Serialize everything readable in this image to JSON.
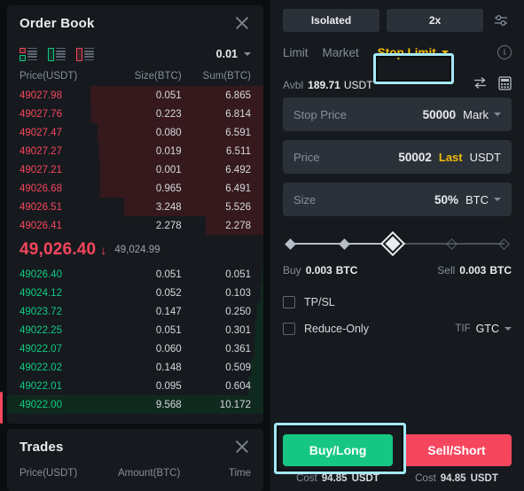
{
  "order_book": {
    "title": "Order Book",
    "close_icon": "close-icon",
    "layout_icons": [
      "orderbook-layout-both-icon",
      "orderbook-layout-bids-icon",
      "orderbook-layout-asks-icon"
    ],
    "tick_size": "0.01",
    "columns": {
      "price": "Price(USDT)",
      "size": "Size(BTC)",
      "sum": "Sum(BTC)"
    },
    "asks": [
      {
        "price": "49027.98",
        "size": "0.051",
        "sum": "6.865",
        "depth_pct": 67.5
      },
      {
        "price": "49027.76",
        "size": "0.223",
        "sum": "6.814",
        "depth_pct": 67.0
      },
      {
        "price": "49027.47",
        "size": "0.080",
        "sum": "6.591",
        "depth_pct": 64.8
      },
      {
        "price": "49027.27",
        "size": "0.019",
        "sum": "6.511",
        "depth_pct": 64.0
      },
      {
        "price": "49027.21",
        "size": "0.001",
        "sum": "6.492",
        "depth_pct": 63.8
      },
      {
        "price": "49026.68",
        "size": "0.965",
        "sum": "6.491",
        "depth_pct": 63.8
      },
      {
        "price": "49026.51",
        "size": "3.248",
        "sum": "5.526",
        "depth_pct": 54.3
      },
      {
        "price": "49026.41",
        "size": "2.278",
        "sum": "2.278",
        "depth_pct": 22.4
      }
    ],
    "mid": {
      "price": "49,026.40",
      "direction_icon": "arrow-down-icon",
      "mark_price": "49,024.99"
    },
    "bids": [
      {
        "price": "49026.40",
        "size": "0.051",
        "sum": "0.051",
        "depth_pct": 0.5,
        "highlight": false
      },
      {
        "price": "49024.12",
        "size": "0.052",
        "sum": "0.103",
        "depth_pct": 1.0,
        "highlight": false
      },
      {
        "price": "49023.72",
        "size": "0.147",
        "sum": "0.250",
        "depth_pct": 2.5,
        "highlight": false
      },
      {
        "price": "49022.25",
        "size": "0.051",
        "sum": "0.301",
        "depth_pct": 3.0,
        "highlight": false
      },
      {
        "price": "49022.07",
        "size": "0.060",
        "sum": "0.361",
        "depth_pct": 3.5,
        "highlight": false
      },
      {
        "price": "49022.02",
        "size": "0.148",
        "sum": "0.509",
        "depth_pct": 5.0,
        "highlight": false
      },
      {
        "price": "49022.01",
        "size": "0.095",
        "sum": "0.604",
        "depth_pct": 5.9,
        "highlight": false
      },
      {
        "price": "49022.00",
        "size": "9.568",
        "sum": "10.172",
        "depth_pct": 100,
        "highlight": true
      }
    ]
  },
  "trades": {
    "title": "Trades",
    "close_icon": "close-icon",
    "columns": {
      "price": "Price(USDT)",
      "amount": "Amount(BTC)",
      "time": "Time"
    }
  },
  "order_form": {
    "margin_mode": "Isolated",
    "leverage": "2x",
    "settings_icon": "sliders-icon",
    "order_types": [
      "Limit",
      "Market",
      "Stop Limit"
    ],
    "active_order_type": "Stop Limit",
    "info_icon": "info-icon",
    "available": {
      "label": "Avbl",
      "value": "189.71",
      "currency": "USDT"
    },
    "swap_icon": "swap-icon",
    "calculator_icon": "calculator-icon",
    "fields": [
      {
        "label": "Stop Price",
        "value": "50000",
        "unit": "Mark",
        "unit_style": "plain",
        "has_caret": true
      },
      {
        "label": "Price",
        "value": "50002",
        "unit": "Last",
        "unit_style": "amber",
        "unit2": "USDT",
        "has_caret": false
      },
      {
        "label": "Size",
        "value": "50%",
        "unit": "BTC",
        "unit_style": "plain",
        "has_caret": true
      }
    ],
    "slider": {
      "percent": 50,
      "nodes": 5
    },
    "buy_qty": {
      "label": "Buy",
      "value": "0.003",
      "unit": "BTC"
    },
    "sell_qty": {
      "label": "Sell",
      "value": "0.003",
      "unit": "BTC"
    },
    "tpsl": {
      "label": "TP/SL",
      "checked": false
    },
    "reduce_only": {
      "label": "Reduce-Only",
      "checked": false
    },
    "tif": {
      "label": "TIF",
      "value": "GTC"
    },
    "buy_button": "Buy/Long",
    "sell_button": "Sell/Short",
    "buy_cost": {
      "label": "Cost",
      "value": "94.85",
      "currency": "USDT"
    },
    "sell_cost": {
      "label": "Cost",
      "value": "94.85",
      "currency": "USDT"
    }
  },
  "colors": {
    "buy": "#16c784",
    "sell": "#f6465d",
    "accent": "#f0b90b",
    "annotation": "#a5e8f5"
  }
}
